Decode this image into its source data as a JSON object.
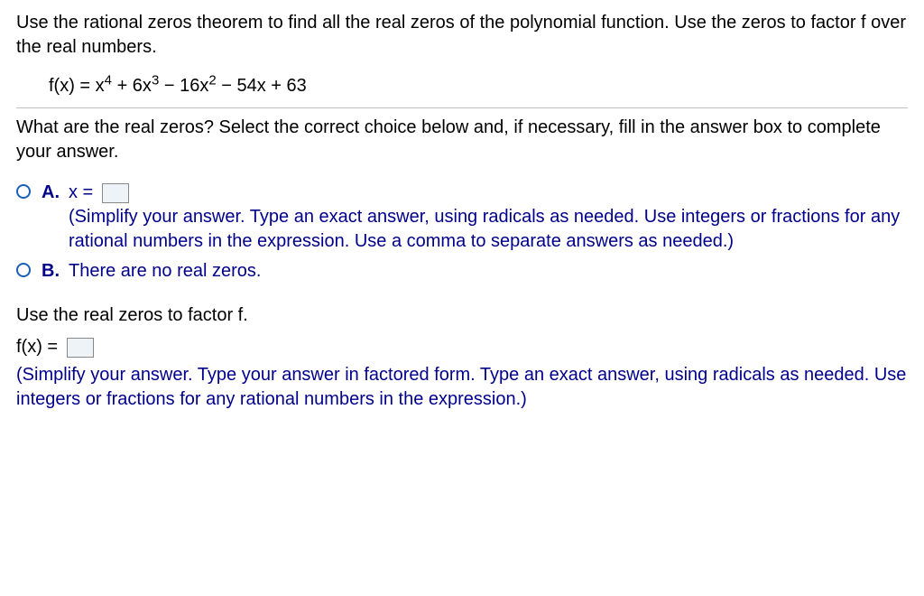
{
  "problem": {
    "instructions": "Use the rational zeros theorem to find all the real zeros of the polynomial function.  Use the zeros to factor f over the real numbers.",
    "fx_label": "f(x) = ",
    "poly_terms": {
      "t1_coef": "x",
      "t1_exp": "4",
      "t2": " + 6x",
      "t2_exp": "3",
      "t3": " − 16x",
      "t3_exp": "2",
      "t4": " − 54x + 63"
    }
  },
  "question1": {
    "prompt": "What are the real zeros? Select the correct choice below and, if necessary, fill in the answer box to complete your answer."
  },
  "choices": {
    "a": {
      "letter": "A.",
      "prefix": "x = ",
      "hint": "(Simplify your answer. Type an exact answer, using radicals as needed. Use integers or fractions for any rational numbers in the expression. Use a comma to separate answers as needed.)"
    },
    "b": {
      "letter": "B.",
      "text": "There are no real zeros."
    }
  },
  "question2": {
    "prompt": "Use the real zeros to factor f.",
    "fx_label": "f(x) = ",
    "hint": "(Simplify your answer. Type your answer in factored form. Type an exact answer, using radicals as needed. Use integers or fractions for any rational numbers in the expression.)"
  }
}
